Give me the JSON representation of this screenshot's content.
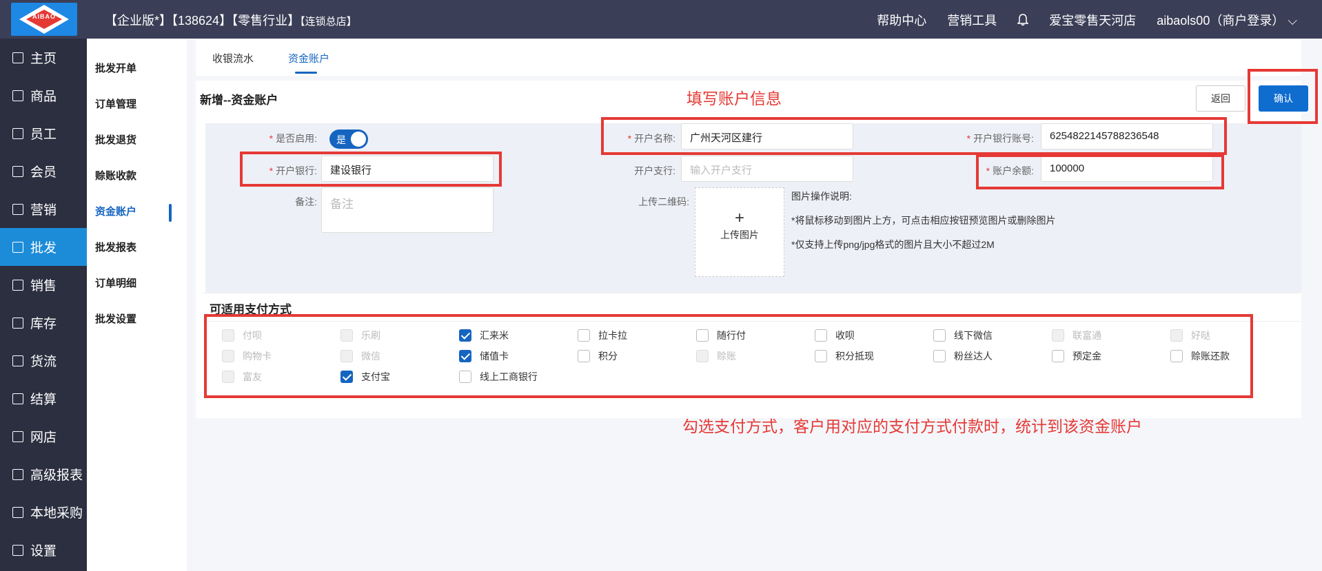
{
  "header": {
    "title_main": "【企业版*】【138624】【零售行业】",
    "title_sub": "【连锁总店】",
    "logo_text": "AIBAO",
    "help": "帮助中心",
    "marketing_tools": "营销工具",
    "store_name": "爱宝零售天河店",
    "user": "aibaols00（商户登录）"
  },
  "sidebar": {
    "items": [
      {
        "label": "主页"
      },
      {
        "label": "商品"
      },
      {
        "label": "员工"
      },
      {
        "label": "会员"
      },
      {
        "label": "营销"
      },
      {
        "label": "批发"
      },
      {
        "label": "销售"
      },
      {
        "label": "库存"
      },
      {
        "label": "货流"
      },
      {
        "label": "结算"
      },
      {
        "label": "网店"
      },
      {
        "label": "高级报表"
      },
      {
        "label": "本地采购"
      },
      {
        "label": "设置"
      }
    ]
  },
  "subnav": {
    "items": [
      {
        "label": "批发开单"
      },
      {
        "label": "订单管理"
      },
      {
        "label": "批发退货"
      },
      {
        "label": "赊账收款"
      },
      {
        "label": "资金账户"
      },
      {
        "label": "批发报表"
      },
      {
        "label": "订单明细"
      },
      {
        "label": "批发设置"
      }
    ]
  },
  "tabs": [
    {
      "label": "收银流水"
    },
    {
      "label": "资金账户"
    }
  ],
  "panel": {
    "title": "新增--资金账户",
    "back_label": "返回",
    "confirm_label": "确认"
  },
  "form": {
    "enabled_label": "是否启用:",
    "enabled_value": "是",
    "account_name_label": "开户名称:",
    "account_name_value": "广州天河区建行",
    "bank_account_label": "开户银行账号:",
    "bank_account_value": "6254822145788236548",
    "bank_label": "开户银行:",
    "bank_value": "建设银行",
    "branch_label": "开户支行:",
    "branch_placeholder": "输入开户支行",
    "balance_label": "账户余额:",
    "balance_value": "100000",
    "remark_label": "备注:",
    "remark_placeholder": "备注",
    "qrcode_label": "上传二维码:",
    "upload_label": "上传图片",
    "upload_plus": "+",
    "upload_desc": [
      "图片操作说明:",
      "*将鼠标移动到图片上方，可点击相应按钮预览图片或删除图片",
      "*仅支持上传png/jpg格式的图片且大小不超过2M"
    ]
  },
  "payment": {
    "title": "可适用支付方式",
    "methods": [
      {
        "label": "付呗",
        "checked": false,
        "disabled": true
      },
      {
        "label": "乐刷",
        "checked": false,
        "disabled": true
      },
      {
        "label": "汇来米",
        "checked": true,
        "disabled": false
      },
      {
        "label": "拉卡拉",
        "checked": false,
        "disabled": false
      },
      {
        "label": "随行付",
        "checked": false,
        "disabled": false
      },
      {
        "label": "收呗",
        "checked": false,
        "disabled": false
      },
      {
        "label": "线下微信",
        "checked": false,
        "disabled": false
      },
      {
        "label": "联富通",
        "checked": false,
        "disabled": true
      },
      {
        "label": "好哒",
        "checked": false,
        "disabled": true
      },
      {
        "label": "购物卡",
        "checked": false,
        "disabled": true
      },
      {
        "label": "微信",
        "checked": false,
        "disabled": true
      },
      {
        "label": "储值卡",
        "checked": true,
        "disabled": false
      },
      {
        "label": "积分",
        "checked": false,
        "disabled": false
      },
      {
        "label": "赊账",
        "checked": false,
        "disabled": true
      },
      {
        "label": "积分抵现",
        "checked": false,
        "disabled": false
      },
      {
        "label": "粉丝达人",
        "checked": false,
        "disabled": false
      },
      {
        "label": "预定金",
        "checked": false,
        "disabled": false
      },
      {
        "label": "赊账还款",
        "checked": false,
        "disabled": false
      },
      {
        "label": "富友",
        "checked": false,
        "disabled": true
      },
      {
        "label": "支付宝",
        "checked": true,
        "disabled": false
      },
      {
        "label": "线上工商银行",
        "checked": false,
        "disabled": false
      }
    ]
  },
  "annotations": {
    "fill_info": "填写账户信息",
    "select_payment": "勾选支付方式，客户用对应的支付方式付款时，统计到该资金账户"
  },
  "colors": {
    "accent": "#1565c0",
    "sidebar_active": "#1d8cd8",
    "annotation": "#e53935",
    "topbar": "#3b3e57"
  }
}
